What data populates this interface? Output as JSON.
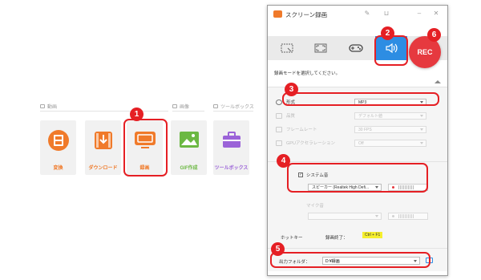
{
  "launcher": {
    "sections": [
      {
        "label": "動画"
      },
      {
        "label": "画像"
      },
      {
        "label": "ツールボックス"
      }
    ],
    "tiles": [
      {
        "label": "変換",
        "icon": "film-icon",
        "color": "#f07a2a"
      },
      {
        "label": "ダウンロード",
        "icon": "download-icon",
        "color": "#f07a2a"
      },
      {
        "label": "録画",
        "icon": "monitor-icon",
        "color": "#f07a2a"
      },
      {
        "label": "GIF作成",
        "icon": "image-icon",
        "color": "#6cb843"
      },
      {
        "label": "ツールボックス",
        "icon": "toolbox-icon",
        "color": "#9b63d8"
      }
    ]
  },
  "recorder": {
    "title": "スクリーン録画",
    "mode_hint": "録画モードを選択してください。",
    "rec_label": "REC",
    "modes": [
      {
        "icon": "region-select-icon"
      },
      {
        "icon": "fullscreen-icon"
      },
      {
        "icon": "gamepad-icon"
      },
      {
        "icon": "speaker-audio-icon",
        "active": true
      }
    ],
    "settings": {
      "format": {
        "label": "形式",
        "value": "MP3"
      },
      "quality": {
        "label": "品質",
        "value": "デフォルト値"
      },
      "framerate": {
        "label": "フレームレート",
        "value": "30 FPS"
      },
      "gpu": {
        "label": "GPUアクセラレーション",
        "value": "Off"
      }
    },
    "audio": {
      "system_label": "システム音",
      "system_checked": true,
      "system_device": "スピーカー (Realtek High Defi...",
      "mic_label": "マイク音",
      "mic_device": ""
    },
    "hotkey": {
      "label": "ホットキー",
      "stop_label": "録画終了：",
      "stop_value": "Ctrl + F1"
    },
    "output": {
      "label": "出力フォルダ：",
      "path": "D:¥録画"
    }
  },
  "annotations": {
    "badges": [
      "1",
      "2",
      "3",
      "4",
      "5",
      "6"
    ],
    "color": "#e51f24"
  },
  "colors": {
    "accent_orange": "#f07a2a",
    "active_mode_blue": "#2d8de3",
    "rec_red": "#e6393f",
    "hotkey_highlight": "#f6ef2e"
  }
}
